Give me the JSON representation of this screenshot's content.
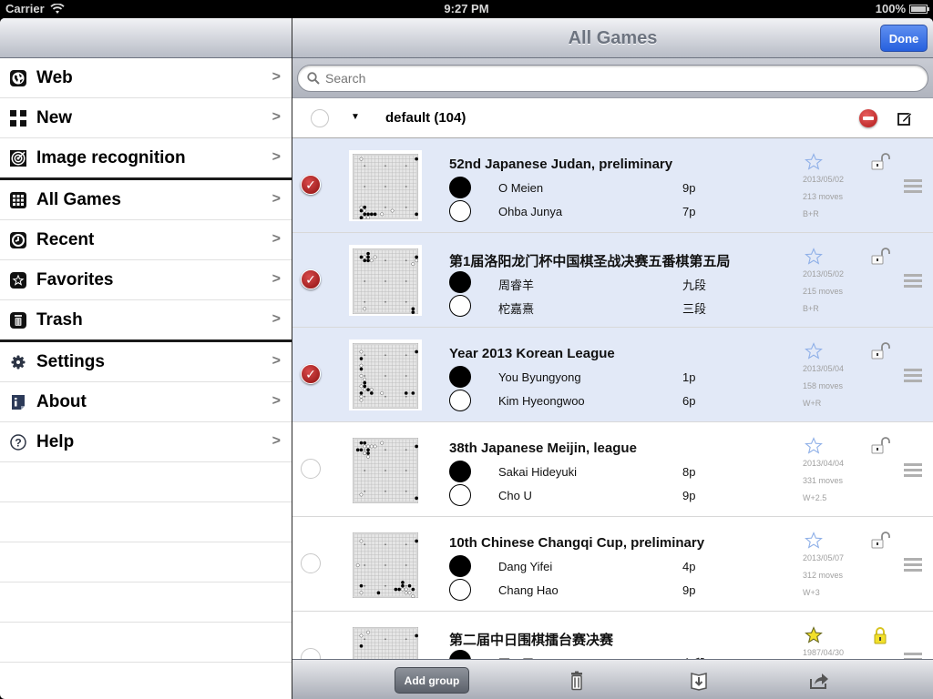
{
  "status_bar": {
    "carrier": "Carrier",
    "time": "9:27 PM",
    "battery": "100%"
  },
  "sidebar": {
    "items": [
      {
        "label": "Web",
        "icon": "globe-icon"
      },
      {
        "label": "New",
        "icon": "board-grid-icon"
      },
      {
        "label": "Image recognition",
        "icon": "target-icon"
      },
      {
        "label": "All Games",
        "icon": "grid-icon"
      },
      {
        "label": "Recent",
        "icon": "clock-icon"
      },
      {
        "label": "Favorites",
        "icon": "star-icon"
      },
      {
        "label": "Trash",
        "icon": "trash-icon"
      },
      {
        "label": "Settings",
        "icon": "gear-icon"
      },
      {
        "label": "About",
        "icon": "info-icon"
      },
      {
        "label": "Help",
        "icon": "help-icon"
      }
    ],
    "chevron": ">"
  },
  "main": {
    "title": "All Games",
    "done_label": "Done",
    "search": {
      "placeholder": "Search",
      "value": ""
    },
    "group": {
      "name": "default (104)",
      "caret": "▼"
    },
    "games": [
      {
        "title": "52nd Japanese Judan, preliminary",
        "black": "O Meien",
        "black_rank": "9p",
        "white": "Ohba Junya",
        "white_rank": "7p",
        "date": "2013/05/02",
        "moves": "213 moves",
        "result": "B+R",
        "selected": true,
        "favorite": false,
        "locked": false
      },
      {
        "title": "第1届洛阳龙门杯中国棋圣战决赛五番棋第五局",
        "black": "周睿羊",
        "black_rank": "九段",
        "white": "柁嘉熹",
        "white_rank": "三段",
        "date": "2013/05/02",
        "moves": "215 moves",
        "result": "B+R",
        "selected": true,
        "favorite": false,
        "locked": false
      },
      {
        "title": "Year 2013 Korean League",
        "black": "You Byungyong",
        "black_rank": "1p",
        "white": "Kim Hyeongwoo",
        "white_rank": "6p",
        "date": "2013/05/04",
        "moves": "158 moves",
        "result": "W+R",
        "selected": true,
        "favorite": false,
        "locked": false
      },
      {
        "title": "38th Japanese Meijin, league",
        "black": "Sakai Hideyuki",
        "black_rank": "8p",
        "white": "Cho U",
        "white_rank": "9p",
        "date": "2013/04/04",
        "moves": "331 moves",
        "result": "W+2.5",
        "selected": false,
        "favorite": false,
        "locked": false
      },
      {
        "title": "10th Chinese Changqi Cup, preliminary",
        "black": "Dang Yifei",
        "black_rank": "4p",
        "white": "Chang Hao",
        "white_rank": "9p",
        "date": "2013/05/07",
        "moves": "312 moves",
        "result": "W+3",
        "selected": false,
        "favorite": false,
        "locked": false
      },
      {
        "title": "第二届中日围棋擂台赛决赛",
        "black": "聂卫平",
        "black_rank": "九段",
        "white": "",
        "white_rank": "",
        "date": "1987/04/30",
        "moves": "",
        "result": "",
        "selected": false,
        "favorite": true,
        "locked": true
      }
    ]
  },
  "toolbar": {
    "add_group_label": "Add group"
  },
  "colors": {
    "accent": "#2660de",
    "selected_row": "#e2e9f7",
    "check_red": "#b01818",
    "star_outline": "#8fb0e8",
    "star_fav": "#f2e02a"
  }
}
